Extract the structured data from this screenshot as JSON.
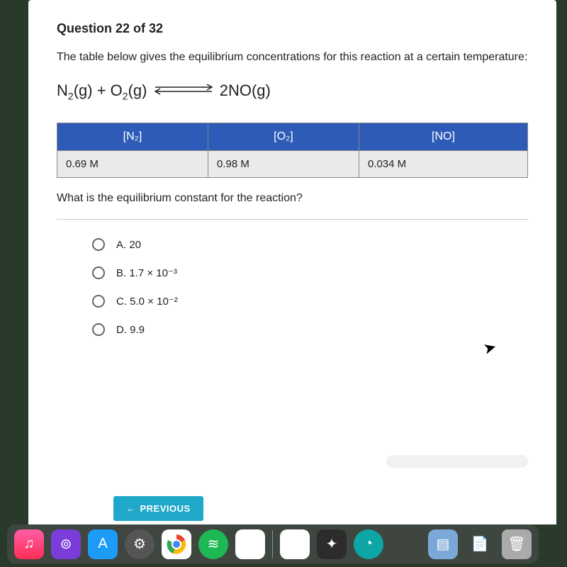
{
  "question": {
    "number_label": "Question 22 of 32",
    "prompt": "The table below gives the equilibrium concentrations for this reaction at a certain temperature:",
    "equation_lhs_a": "N",
    "equation_lhs_a_sub": "2",
    "equation_lhs_a_state": "(g)",
    "equation_plus": " + ",
    "equation_lhs_b": "O",
    "equation_lhs_b_sub": "2",
    "equation_lhs_b_state": "(g)",
    "equation_rhs": "2NO(g)",
    "sub_question": "What is the equilibrium constant for the reaction?"
  },
  "table": {
    "headers": {
      "n2": "[N₂]",
      "o2": "[O₂]",
      "no": "[NO]"
    },
    "row": {
      "n2": "0.69 M",
      "o2": "0.98 M",
      "no": "0.034 M"
    }
  },
  "options": {
    "a": "A.  20",
    "b": "B.  1.7 × 10⁻³",
    "c": "C.  5.0 × 10⁻²",
    "d": "D.  9.9"
  },
  "nav": {
    "previous": "PREVIOUS"
  },
  "dock": {
    "music": "♫",
    "podcast": "⊚",
    "appstore": "A",
    "settings": "⚙",
    "chrome": "◉",
    "spotify": "≋",
    "roblox": "◻",
    "zoom": "▣",
    "adobe": "✦",
    "pb": "◔",
    "folder": "▤",
    "trash": "🗑"
  }
}
